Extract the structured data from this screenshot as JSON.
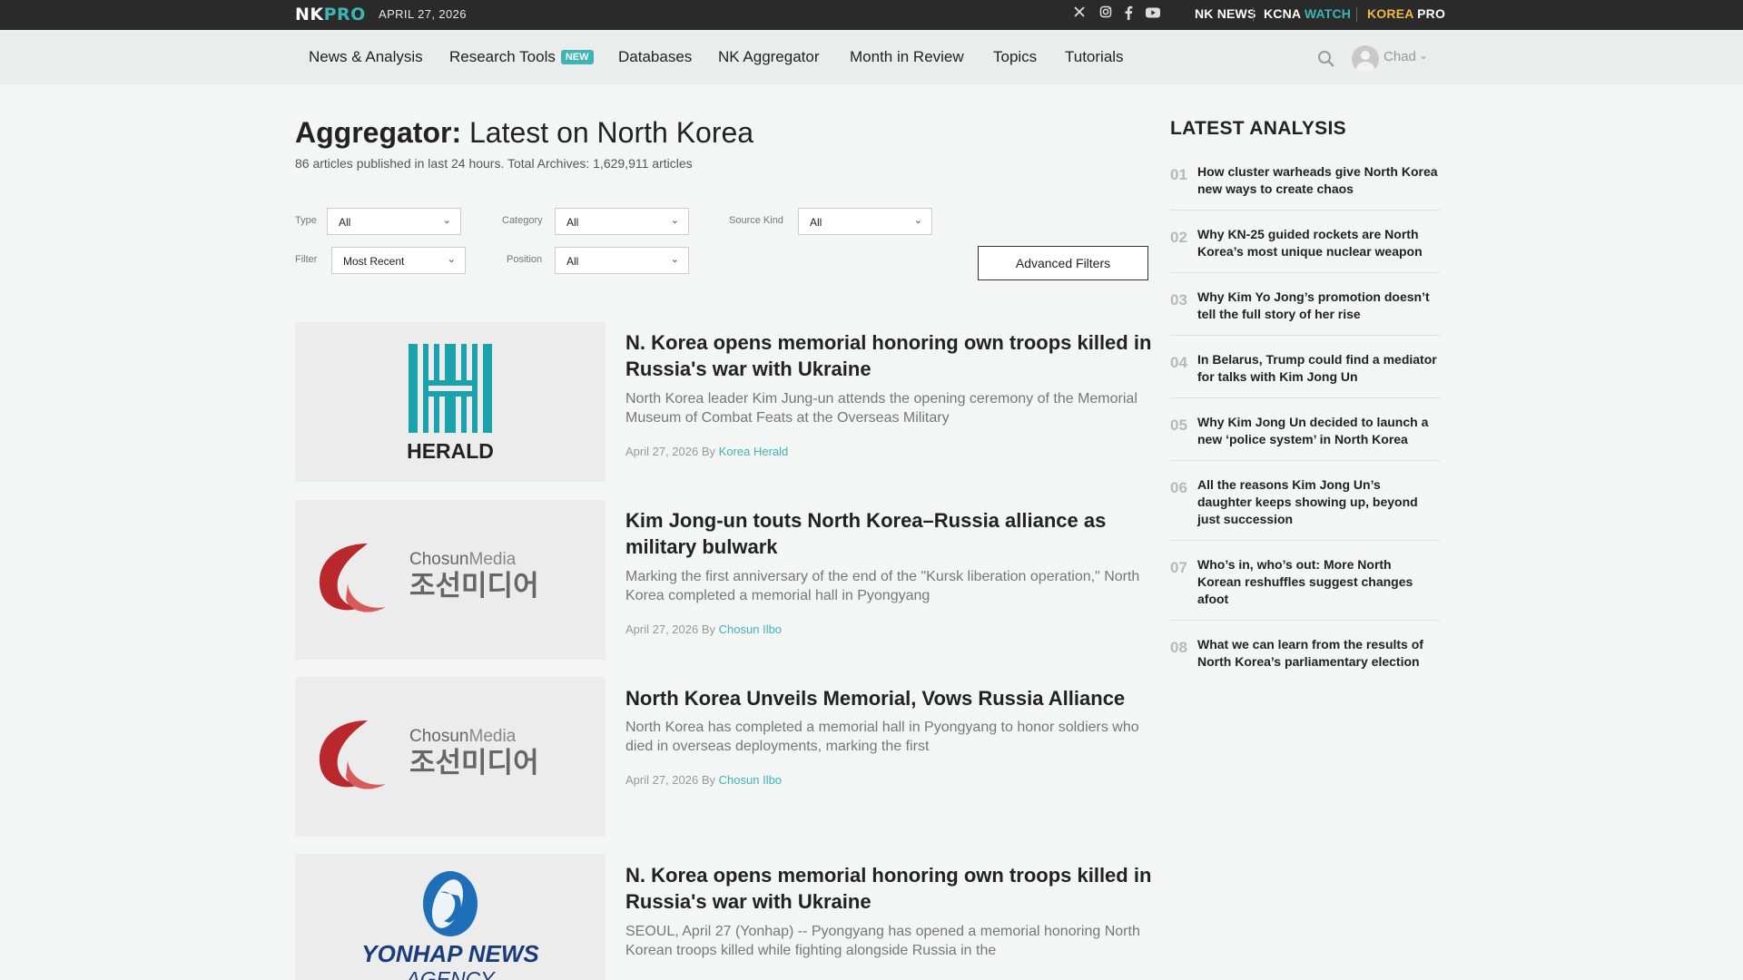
{
  "topbar": {
    "logo_nk": "NK",
    "logo_pro": "PRO",
    "date": "APRIL 27, 2026",
    "social_icons": [
      "x-icon",
      "instagram-icon",
      "facebook-icon",
      "youtube-icon"
    ],
    "brands": {
      "nknews": "NK NEWS",
      "kcna_1": "KCNA",
      "kcna_2": "WATCH",
      "korea_1": "KOREA",
      "korea_2": "PRO"
    }
  },
  "nav": {
    "items": [
      "News & Analysis",
      "Research Tools",
      "Databases",
      "NK Aggregator",
      "Month in Review",
      "Topics",
      "Tutorials"
    ],
    "new_badge": "NEW",
    "user": "Chad"
  },
  "page": {
    "title_bold": "Aggregator:",
    "title_rest": "Latest on North Korea",
    "stats": "86 articles published in last 24 hours. Total Archives: 1,629,911 articles"
  },
  "filters": {
    "type_label": "Type",
    "type_value": "All",
    "category_label": "Category",
    "category_value": "All",
    "source_label": "Source Kind",
    "source_value": "All",
    "filter_label": "Filter",
    "filter_value": "Most Recent",
    "position_label": "Position",
    "position_value": "All",
    "advanced": "Advanced Filters"
  },
  "articles": [
    {
      "title": "N. Korea opens memorial honoring own troops killed in Russia's war with Ukraine",
      "desc": "North Korea leader Kim Jung-un attends the opening ceremony of the Memorial Museum of Combat Feats at the Overseas Military",
      "date": "April 27, 2026",
      "by": "By",
      "source": "Korea Herald",
      "logo_text": "HERALD"
    },
    {
      "title": "Kim Jong-un touts North Korea–Russia alliance as military bulwark",
      "desc": "Marking the first anniversary of the end of the \"Kursk liberation operation,\" North Korea completed a memorial hall in Pyongyang",
      "date": "April 27, 2026",
      "by": "By",
      "source": "Chosun Ilbo",
      "logo_en_1": "Chosun",
      "logo_en_2": "Media",
      "logo_kr": "조선미디어"
    },
    {
      "title": "North Korea Unveils Memorial, Vows Russia Alliance",
      "desc": "North Korea has completed a memorial hall in Pyongyang to honor soldiers who died in overseas deployments, marking the first",
      "date": "April 27, 2026",
      "by": "By",
      "source": "Chosun Ilbo",
      "logo_en_1": "Chosun",
      "logo_en_2": "Media",
      "logo_kr": "조선미디어"
    },
    {
      "title": "N. Korea opens memorial honoring own troops killed in Russia's war with Ukraine",
      "desc": "SEOUL, April 27 (Yonhap) -- Pyongyang has opened a memorial honoring North Korean troops killed while fighting alongside Russia in the",
      "logo_text_1": "YONHAP NEWS",
      "logo_text_2": "AGENCY"
    }
  ],
  "sidebar": {
    "heading": "LATEST ANALYSIS",
    "items": [
      {
        "num": "01",
        "text": "How cluster warheads give North Korea new ways to create chaos"
      },
      {
        "num": "02",
        "text": "Why KN-25 guided rockets are North Korea’s most unique nuclear weapon"
      },
      {
        "num": "03",
        "text": "Why Kim Yo Jong’s promotion doesn’t tell the full story of her rise"
      },
      {
        "num": "04",
        "text": "In Belarus, Trump could find a mediator for talks with Kim Jong Un"
      },
      {
        "num": "05",
        "text": "Why Kim Jong Un decided to launch a new ‘police system’ in North Korea"
      },
      {
        "num": "06",
        "text": "All the reasons Kim Jong Un’s daughter keeps showing up, beyond just succession"
      },
      {
        "num": "07",
        "text": "Who’s in, who’s out: More North Korean reshuffles suggest changes afoot"
      },
      {
        "num": "08",
        "text": "What we can learn from the results of North Korea’s parliamentary election"
      }
    ]
  }
}
